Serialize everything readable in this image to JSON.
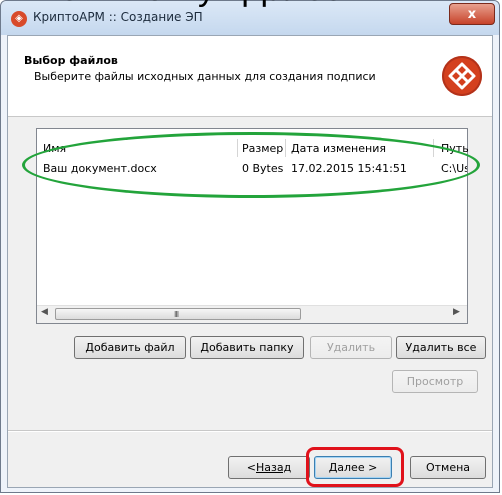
{
  "window": {
    "title": "КриптоАРМ :: Создание ЭП",
    "close_label": "x"
  },
  "header": {
    "title": "Выбор файлов",
    "subtitle": "Выберите файлы исходных данных для создания подписи"
  },
  "file_list": {
    "columns": [
      "Имя",
      "Размер",
      "Дата изменения",
      "Путь"
    ],
    "rows": [
      {
        "name": "Ваш документ.docx",
        "size": "0 Bytes",
        "modified": "17.02.2015 15:41:51",
        "path": "C:\\Us"
      }
    ],
    "scroll_grip": "III"
  },
  "buttons": {
    "add_file": "Добавить файл",
    "add_folder": "Добавить папку",
    "delete": "Удалить",
    "delete_all": "Удалить все",
    "view": "Просмотр",
    "back_prefix": "< ",
    "back_label": "Назад",
    "next": "Далее >",
    "cancel": "Отмена"
  },
  "top_fragment": "ем кнопку «Далее»"
}
